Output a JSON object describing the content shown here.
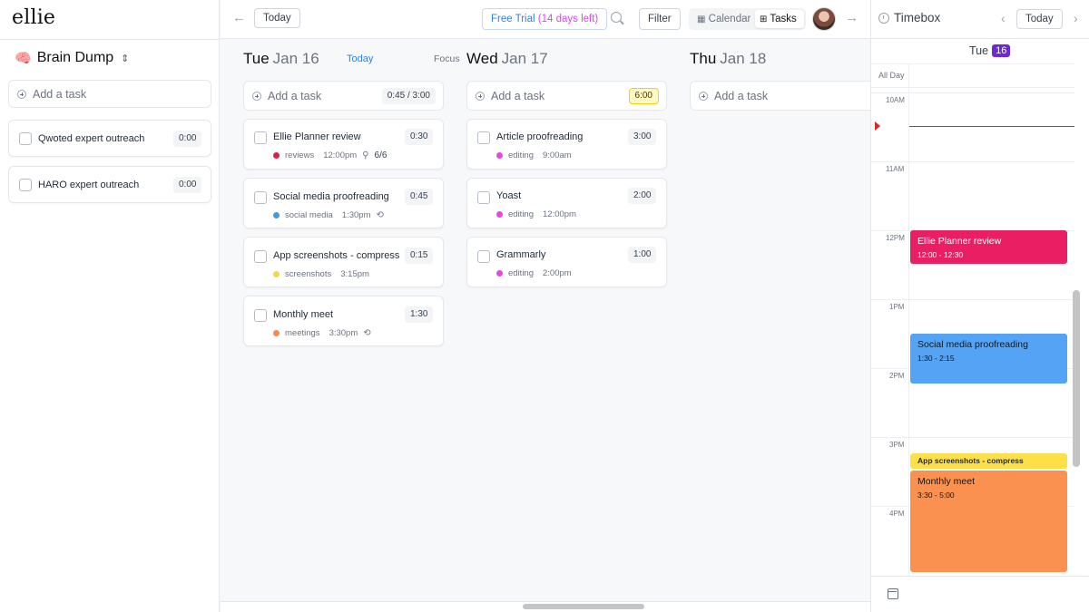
{
  "app": {
    "logo": "ellie"
  },
  "brain_dump": {
    "title": "Brain Dump",
    "brain_icon": "🧠",
    "chevron": "⌃⌄",
    "add_task": "Add a task",
    "tasks": [
      {
        "title": "Qwoted expert outreach",
        "duration": "0:00"
      },
      {
        "title": "HARO expert outreach",
        "duration": "0:00"
      }
    ]
  },
  "topbar": {
    "today": "Today",
    "trial_main": "Free Trial",
    "trial_days": "(14 days left)",
    "filter": "Filter",
    "view_calendar": "Calendar",
    "view_tasks": "Tasks",
    "arrow_left": "←",
    "arrow_right": "→"
  },
  "days": [
    {
      "weekday": "Tue",
      "date": "Jan 16",
      "today_label": "Today",
      "focus_label": "Focus",
      "add_task": "Add a task",
      "ratio": "0:45 / 3:00",
      "tasks": [
        {
          "title": "Ellie Planner review",
          "duration": "0:30",
          "tag": "reviews",
          "tag_color": "#e11d48",
          "time": "12:00pm",
          "extra": "6/6",
          "extra_icon": "📎"
        },
        {
          "title": "Social media proofreading",
          "duration": "0:45",
          "tag": "social media",
          "tag_color": "#4299e1",
          "time": "1:30pm",
          "extra": "",
          "extra_icon": "🔁"
        },
        {
          "title": "App screenshots - compress",
          "duration": "0:15",
          "tag": "screenshots",
          "tag_color": "#f6d743",
          "time": "3:15pm",
          "extra": "",
          "extra_icon": ""
        },
        {
          "title": "Monthly meet",
          "duration": "1:30",
          "tag": "meetings",
          "tag_color": "#f6894a",
          "time": "3:30pm",
          "extra": "",
          "extra_icon": "🔁"
        }
      ]
    },
    {
      "weekday": "Wed",
      "date": "Jan 17",
      "add_task": "Add a task",
      "ratio": "6:00",
      "tasks": [
        {
          "title": "Article proofreading",
          "duration": "3:00",
          "tag": "editing",
          "tag_color": "#e845e8",
          "time": "9:00am"
        },
        {
          "title": "Yoast",
          "duration": "2:00",
          "tag": "editing",
          "tag_color": "#e845e8",
          "time": "12:00pm"
        },
        {
          "title": "Grammarly",
          "duration": "1:00",
          "tag": "editing",
          "tag_color": "#e845e8",
          "time": "2:00pm"
        }
      ]
    },
    {
      "weekday": "Thu",
      "date": "Jan 18",
      "add_task": "Add a task"
    }
  ],
  "timebox": {
    "title": "Timebox",
    "today": "Today",
    "day_label": "Tue",
    "day_num": "16",
    "all_day": "All Day",
    "hours": [
      "10AM",
      "11AM",
      "12PM",
      "1PM",
      "2PM",
      "3PM",
      "4PM"
    ],
    "events": [
      {
        "name": "Ellie Planner review",
        "time": "12:00 - 12:30",
        "color": "#e91e63",
        "text_color": "#ffffff"
      },
      {
        "name": "Social media proofreading",
        "time": "1:30 - 2:15",
        "color": "#54a3f5",
        "text_color": "#0b1b2b"
      },
      {
        "name": "App screenshots - compress",
        "time": "",
        "color": "#fde047",
        "text_color": "#1f2937"
      },
      {
        "name": "Monthly meet",
        "time": "3:30 - 5:00",
        "color": "#fb9150",
        "text_color": "#1f1208"
      }
    ]
  }
}
